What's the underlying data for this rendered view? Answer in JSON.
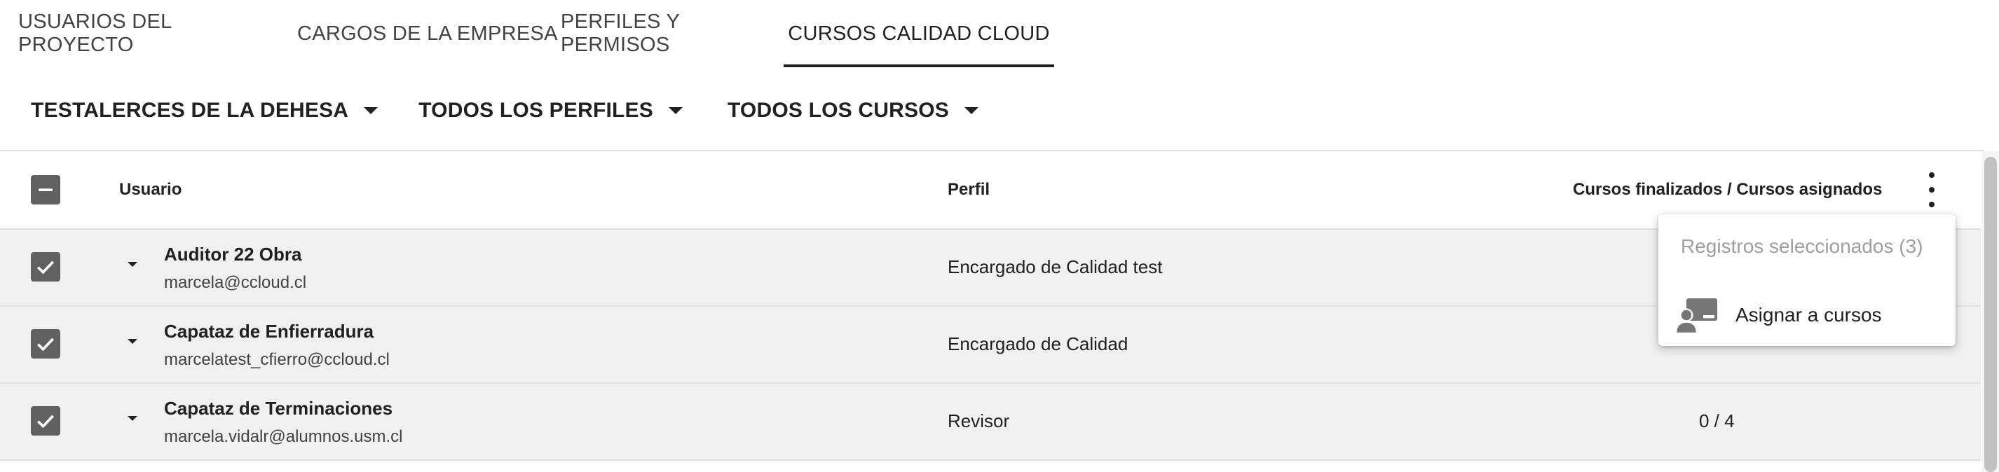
{
  "tabs": [
    {
      "label": "USUARIOS DEL PROYECTO",
      "active": false
    },
    {
      "label": "CARGOS DE LA EMPRESA",
      "active": false
    },
    {
      "label": "PERFILES Y PERMISOS",
      "active": false
    },
    {
      "label": "CURSOS CALIDAD CLOUD",
      "active": true
    }
  ],
  "filters": {
    "company": "TESTALERCES DE LA DEHESA",
    "profiles": "TODOS LOS PERFILES",
    "courses": "TODOS LOS CURSOS"
  },
  "table": {
    "headers": {
      "user": "Usuario",
      "profile": "Perfil",
      "courses": "Cursos finalizados / Cursos asignados"
    },
    "rows": [
      {
        "name": "Auditor 22 Obra",
        "email": "marcela@ccloud.cl",
        "profile": "Encargado de Calidad test",
        "courses": "",
        "checked": true
      },
      {
        "name": "Capataz de Enfierradura",
        "email": "marcelatest_cfierro@ccloud.cl",
        "profile": "Encargado de Calidad",
        "courses": "",
        "checked": true
      },
      {
        "name": "Capataz de Terminaciones",
        "email": "marcela.vidalr@alumnos.usm.cl",
        "profile": "Revisor",
        "courses": "0 / 4",
        "checked": true
      }
    ]
  },
  "menu": {
    "header": "Registros seleccionados (3)",
    "items": [
      {
        "label": "Asignar a cursos",
        "icon": "assign-course-icon"
      }
    ]
  },
  "colors": {
    "checkbox": "#616161",
    "row_bg": "#f0f0f0",
    "text": "#212121",
    "menu_header": "#9e9e9e"
  }
}
